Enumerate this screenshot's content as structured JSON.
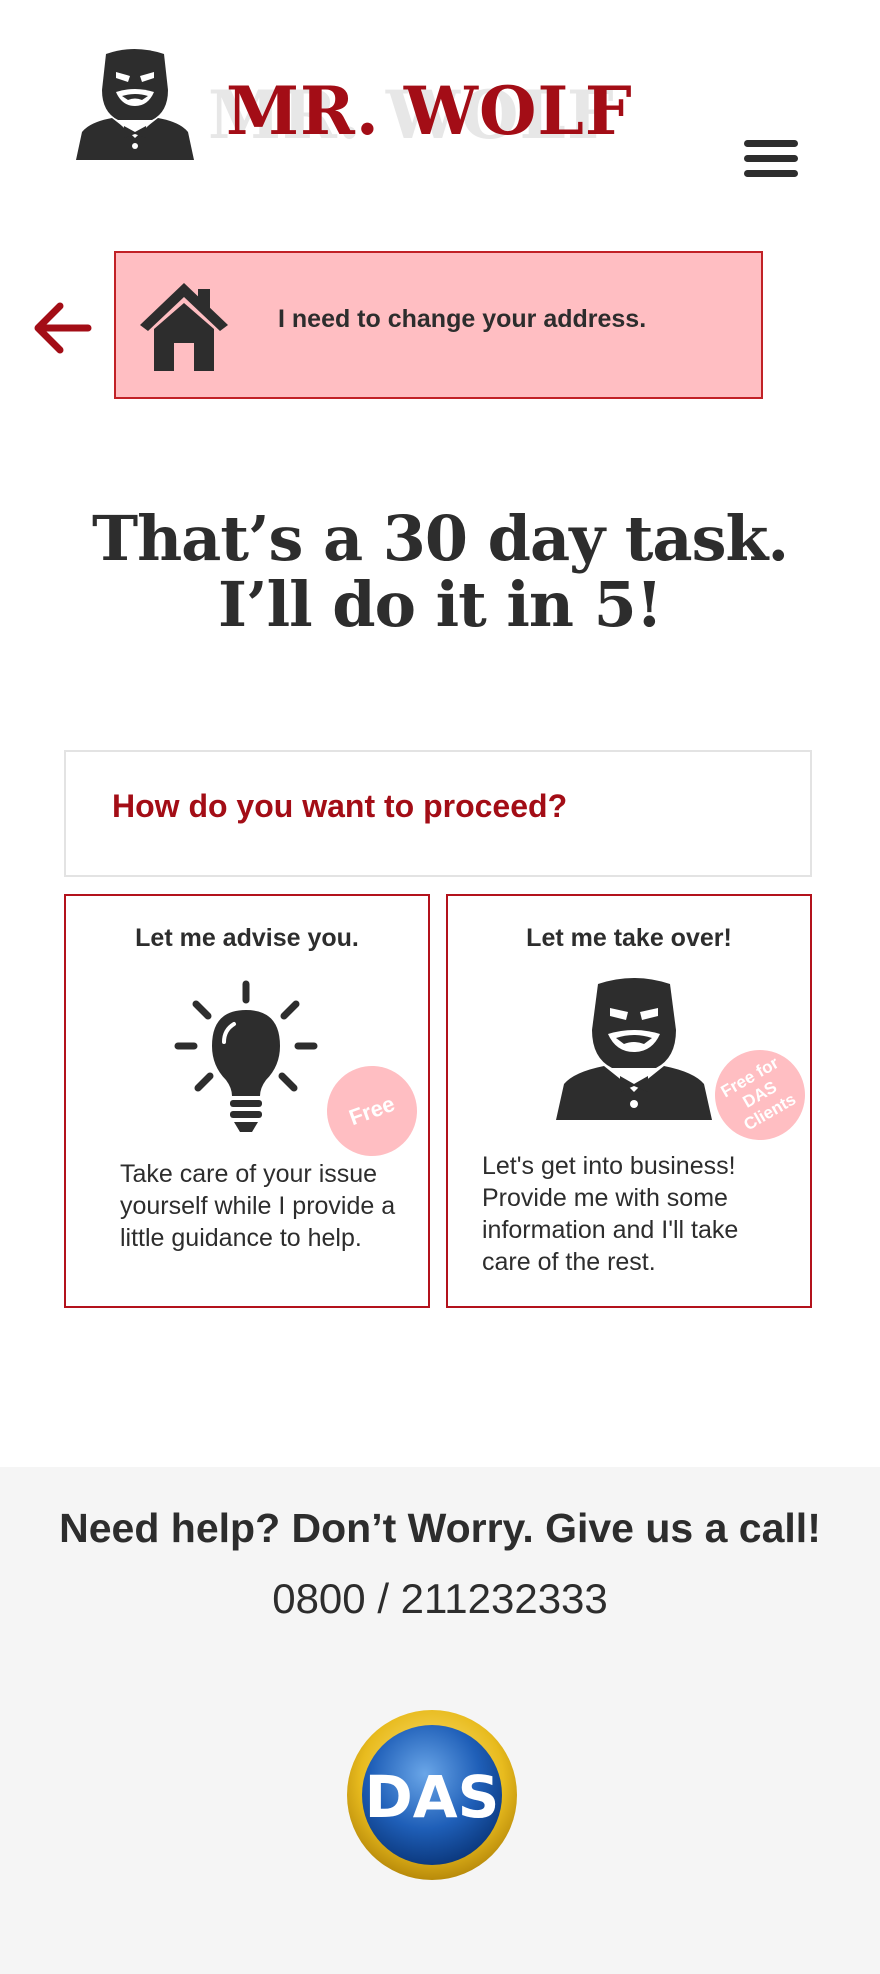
{
  "header": {
    "logo_text": "MR. WOLF",
    "menu_icon": "hamburger-menu-icon"
  },
  "task": {
    "back_icon": "arrow-left-icon",
    "icon": "house-icon",
    "text": "I need to change your address."
  },
  "headline": {
    "line1": "That’s a 30 day task.",
    "line2": "I’ll do it in 5!"
  },
  "proceed": {
    "question": "How do you want to proceed?"
  },
  "options": [
    {
      "title": "Let me advise you.",
      "icon": "lightbulb-icon",
      "badge": "Free",
      "description": "Take care of your issue yourself while I provide a little guidance to help."
    },
    {
      "title": "Let me take over!",
      "icon": "mr-wolf-icon",
      "badge": "Free for DAS Clients",
      "description": "Let's get into business! Provide me with some information and I'll take care of the rest."
    }
  ],
  "footer": {
    "help_title": "Need help? Don’t Worry. Give us a call!",
    "phone": "0800 / 211232333",
    "partner_logo_text": "DAS"
  },
  "colors": {
    "brand_red": "#a30d16",
    "banner_pink": "#ffbec2",
    "text_dark": "#2d2d2d",
    "footer_bg": "#f5f5f5"
  }
}
